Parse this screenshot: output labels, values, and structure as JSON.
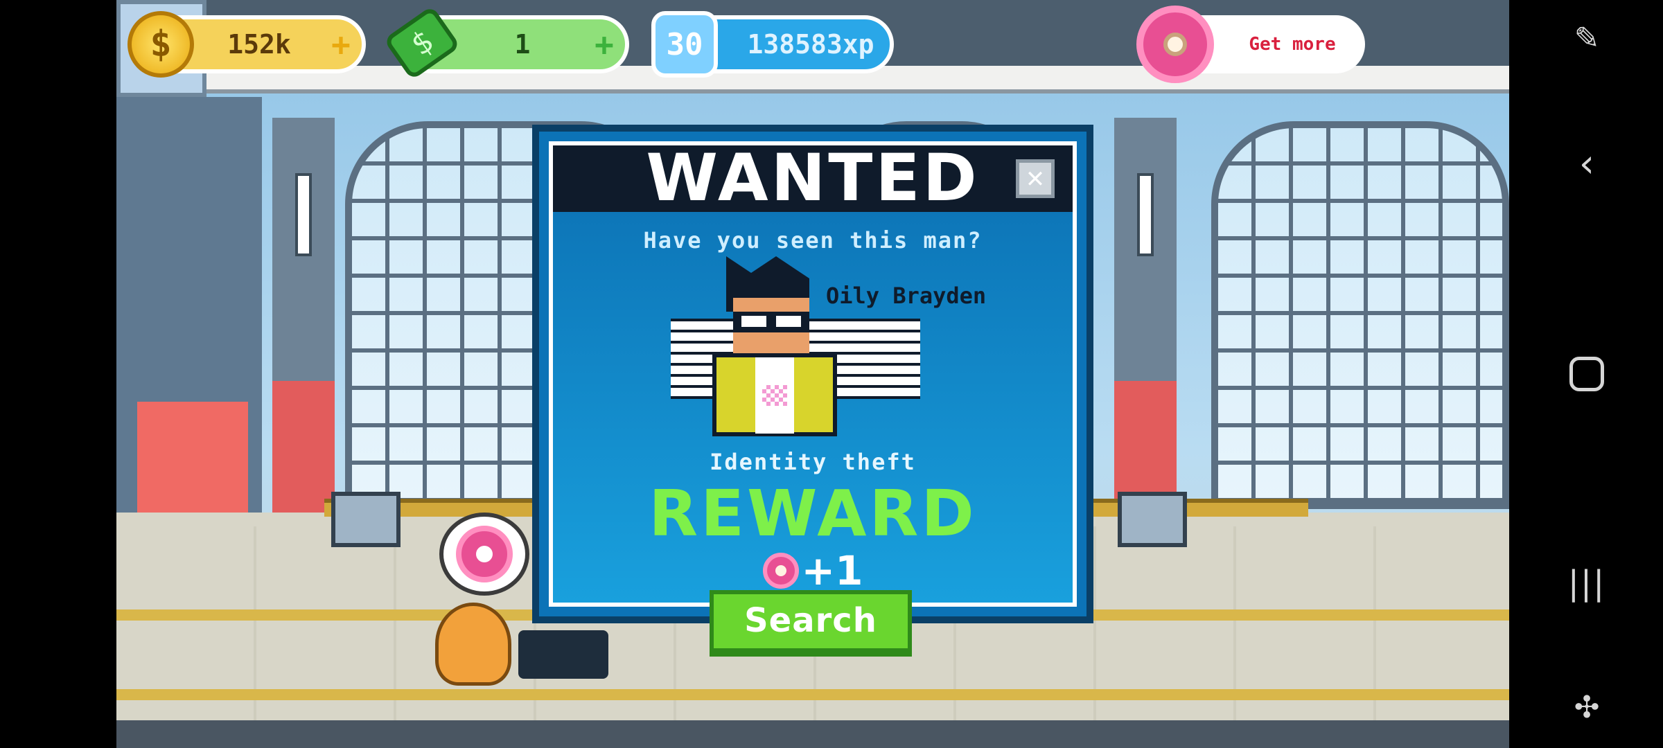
{
  "hud": {
    "coins": {
      "value": "152k",
      "plus": "+",
      "icon": "coin-icon"
    },
    "cash": {
      "value": "1",
      "plus": "+",
      "icon": "cash-icon"
    },
    "xp": {
      "level": "30",
      "value": "138583xp",
      "icon": "level-badge-icon"
    },
    "donuts": {
      "label": "Get more",
      "icon": "donut-icon"
    }
  },
  "wanted_modal": {
    "title": "WANTED",
    "close_symbol": "✕",
    "subtitle": "Have you seen this man?",
    "suspect_name": "Oily Brayden",
    "crime": "Identity theft",
    "reward_title": "REWARD",
    "reward_amount": "+1",
    "reward_icon": "donut-icon",
    "search_label": "Search"
  },
  "colors": {
    "modal_blue": "#0c73b7",
    "reward_green": "#7ef04a",
    "button_green": "#6ad62f",
    "donut_pink": "#e84f93",
    "header_dark": "#0f1b2b"
  },
  "nav": {
    "icons": [
      "screen-edit-icon",
      "back-icon",
      "home-icon",
      "recents-icon",
      "game-tools-icon"
    ]
  }
}
